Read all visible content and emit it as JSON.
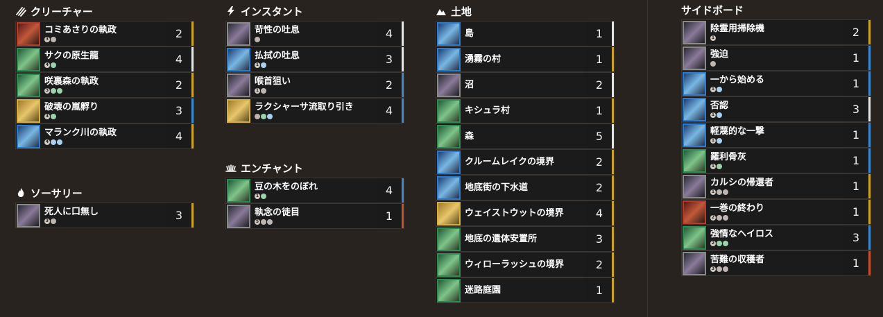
{
  "sections": {
    "creatures": {
      "title": "クリーチャー",
      "icon": "creature-claw-icon",
      "cards": [
        {
          "name": "コミあさりの執政",
          "cost": [
            "3",
            "B"
          ],
          "qty": "2",
          "frame": "red",
          "bar": "gold"
        },
        {
          "name": "サクの原生龍",
          "cost": [
            "4",
            "G"
          ],
          "qty": "4",
          "frame": "green",
          "bar": "white"
        },
        {
          "name": "咲裏森の執政",
          "cost": [
            "3",
            "G",
            "G"
          ],
          "qty": "2",
          "frame": "green",
          "bar": "gold"
        },
        {
          "name": "破壊の嵐孵り",
          "cost": [
            "4",
            "G"
          ],
          "qty": "3",
          "frame": "gold",
          "bar": "blue"
        },
        {
          "name": "マランク川の執政",
          "cost": [
            "4",
            "U",
            "U"
          ],
          "qty": "4",
          "frame": "blue",
          "bar": "gold"
        }
      ]
    },
    "sorcery": {
      "title": "ソーサリー",
      "icon": "sorcery-flame-icon",
      "cards": [
        {
          "name": "死人に口無し",
          "cost": [
            "3",
            "B"
          ],
          "qty": "3",
          "frame": "gray",
          "bar": "gold"
        }
      ]
    },
    "instants": {
      "title": "インスタント",
      "icon": "instant-bolt-icon",
      "cards": [
        {
          "name": "苛性の吐息",
          "cost": [
            "B"
          ],
          "qty": "4",
          "frame": "gray",
          "bar": "white"
        },
        {
          "name": "払拭の吐息",
          "cost": [
            "1",
            "U"
          ],
          "qty": "3",
          "frame": "blue",
          "bar": "white"
        },
        {
          "name": "喉首狙い",
          "cost": [
            "1",
            "B"
          ],
          "qty": "2",
          "frame": "gray",
          "bar": "blue"
        },
        {
          "name": "ラクシャーサ流取り引き",
          "cost": [
            "B",
            "G",
            "U"
          ],
          "qty": "4",
          "frame": "gold",
          "bar": "blue"
        }
      ]
    },
    "enchantments": {
      "title": "エンチャント",
      "icon": "enchantment-sun-icon",
      "cards": [
        {
          "name": "豆の木をのぼれ",
          "cost": [
            "1",
            "G"
          ],
          "qty": "4",
          "frame": "green",
          "bar": "blue"
        },
        {
          "name": "執念の徒目",
          "cost": [
            "5",
            "B",
            "B"
          ],
          "qty": "1",
          "frame": "gray",
          "bar": "red"
        }
      ]
    },
    "lands": {
      "title": "土地",
      "icon": "land-mountain-icon",
      "cards": [
        {
          "name": "島",
          "qty": "1",
          "frame": "blue",
          "bar": "white"
        },
        {
          "name": "湧霧の村",
          "qty": "1",
          "frame": "blue",
          "bar": "gold"
        },
        {
          "name": "沼",
          "qty": "2",
          "frame": "gray",
          "bar": "white"
        },
        {
          "name": "キシュラ村",
          "qty": "1",
          "frame": "green",
          "bar": "gold"
        },
        {
          "name": "森",
          "qty": "5",
          "frame": "green",
          "bar": "white"
        },
        {
          "name": "クルームレイクの境界",
          "qty": "2",
          "frame": "blue",
          "bar": "gold"
        },
        {
          "name": "地底街の下水道",
          "qty": "2",
          "frame": "blue",
          "bar": "gold"
        },
        {
          "name": "ウェイストウットの境界",
          "qty": "4",
          "frame": "gold",
          "bar": "gold"
        },
        {
          "name": "地底の遺体安置所",
          "qty": "3",
          "frame": "green",
          "bar": "gold"
        },
        {
          "name": "ウィローラッシュの境界",
          "qty": "2",
          "frame": "green",
          "bar": "gold"
        },
        {
          "name": "迷路庭園",
          "qty": "1",
          "frame": "green",
          "bar": "gold"
        }
      ]
    },
    "sideboard": {
      "title": "サイドボード",
      "cards": [
        {
          "name": "除霊用掃除機",
          "cost": [
            "1"
          ],
          "qty": "2",
          "frame": "gray",
          "bar": "gold"
        },
        {
          "name": "強迫",
          "cost": [
            "B"
          ],
          "qty": "1",
          "frame": "gray",
          "bar": "blue"
        },
        {
          "name": "一から始める",
          "cost": [
            "1",
            "U"
          ],
          "qty": "1",
          "frame": "blue",
          "bar": "blue"
        },
        {
          "name": "否認",
          "cost": [
            "1",
            "U"
          ],
          "qty": "3",
          "frame": "blue",
          "bar": "white"
        },
        {
          "name": "軽蔑的な一撃",
          "cost": [
            "1",
            "U"
          ],
          "qty": "1",
          "frame": "blue",
          "bar": "blue"
        },
        {
          "name": "羅利骨灰",
          "cost": [
            "1",
            "G"
          ],
          "qty": "1",
          "frame": "green",
          "bar": "blue"
        },
        {
          "name": "カルシの帰還者",
          "cost": [
            "1",
            "B",
            "B"
          ],
          "qty": "1",
          "frame": "gray",
          "bar": "gold"
        },
        {
          "name": "一巻の終わり",
          "cost": [
            "2",
            "B",
            "B"
          ],
          "qty": "1",
          "frame": "red",
          "bar": "gold"
        },
        {
          "name": "強情なヘイロス",
          "cost": [
            "2",
            "G",
            "G"
          ],
          "qty": "3",
          "frame": "green",
          "bar": "blue"
        },
        {
          "name": "苦難の収穫者",
          "cost": [
            "3",
            "B",
            "B"
          ],
          "qty": "1",
          "frame": "gray",
          "bar": "red"
        }
      ]
    }
  },
  "colors": {
    "background": "#28231f",
    "row": "#1b1b1b",
    "bar_gold": "#c9a227",
    "bar_blue": "#3d87cc",
    "bar_red": "#c0502f",
    "bar_white": "#e6e6e6"
  }
}
